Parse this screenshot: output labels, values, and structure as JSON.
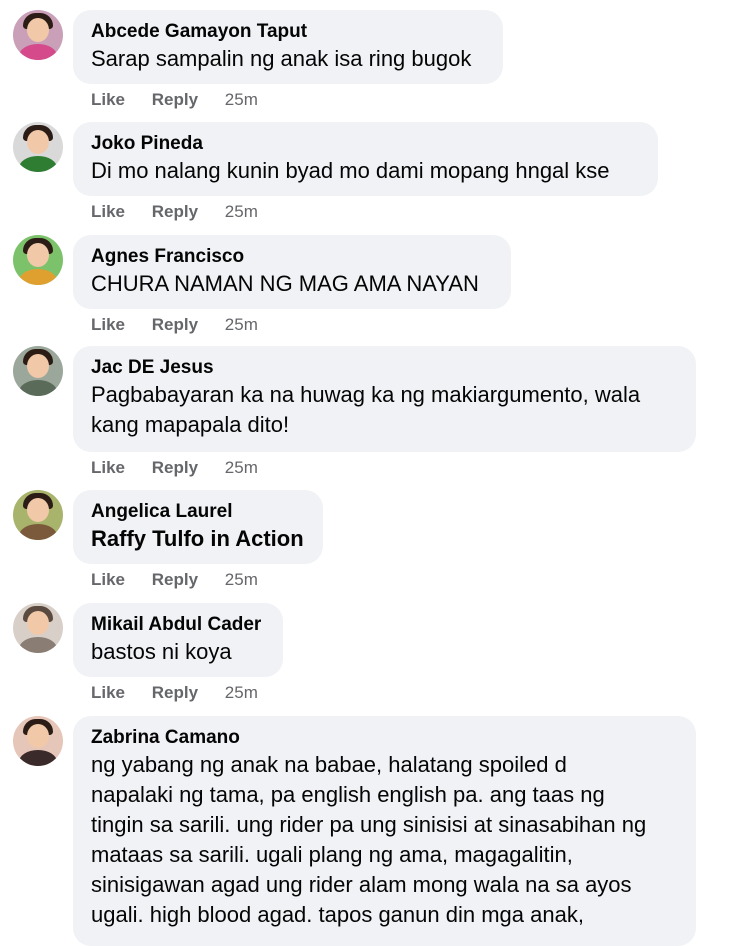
{
  "comments": [
    {
      "author": "Abcede Gamayon Taput",
      "text": "Sarap sampalin ng anak isa ring bugok",
      "like": "Like",
      "reply": "Reply",
      "time": "25m",
      "avatar_icon": "user-avatar",
      "avatar_bg": "#c9a0b8",
      "avatar_shirt": "#d44a8a"
    },
    {
      "author": "Joko Pineda",
      "text": "Di mo nalang kunin byad mo dami mopang hngal kse",
      "like": "Like",
      "reply": "Reply",
      "time": "25m",
      "avatar_icon": "user-avatar",
      "avatar_bg": "#d9d9d9",
      "avatar_shirt": "#2e7d32"
    },
    {
      "author": "Agnes Francisco",
      "text": "CHURA NAMAN NG MAG AMA NAYAN",
      "like": "Like",
      "reply": "Reply",
      "time": "25m",
      "avatar_icon": "user-avatar",
      "avatar_bg": "#7cc26b",
      "avatar_shirt": "#e0a030"
    },
    {
      "author": "Jac DE Jesus",
      "text": "Pagbabayaran ka na huwag ka ng makiargumento, wala\nkang mapapala dito!",
      "like": "Like",
      "reply": "Reply",
      "time": "25m",
      "avatar_icon": "user-avatar",
      "avatar_bg": "#9aa79a",
      "avatar_shirt": "#5a6b5a"
    },
    {
      "author": "Angelica Laurel",
      "text": "Raffy Tulfo in Action",
      "like": "Like",
      "reply": "Reply",
      "time": "25m",
      "avatar_icon": "user-avatar",
      "avatar_bg": "#a8b36c",
      "avatar_shirt": "#7a5a3a"
    },
    {
      "author": "Mikail Abdul Cader",
      "text": "bastos ni koya",
      "like": "Like",
      "reply": "Reply",
      "time": "25m",
      "avatar_icon": "user-avatar",
      "avatar_bg": "#d8cfc8",
      "avatar_shirt": "#8a7d74"
    },
    {
      "author": "Zabrina Camano",
      "text": "ng yabang ng anak na babae, halatang spoiled d\nnapalaki ng tama, pa english english pa. ang taas ng\ntingin sa sarili. ung rider pa ung sinisisi at sinasabihan ng\nmataas sa sarili. ugali plang ng ama, magagalitin,\nsinisigawan agad ung rider alam mong wala na sa ayos\nugali. high blood agad. tapos ganun din mga anak,",
      "like": "",
      "reply": "",
      "time": "",
      "avatar_icon": "user-avatar",
      "avatar_bg": "#e6c6b8",
      "avatar_shirt": "#3a2a2a"
    }
  ]
}
